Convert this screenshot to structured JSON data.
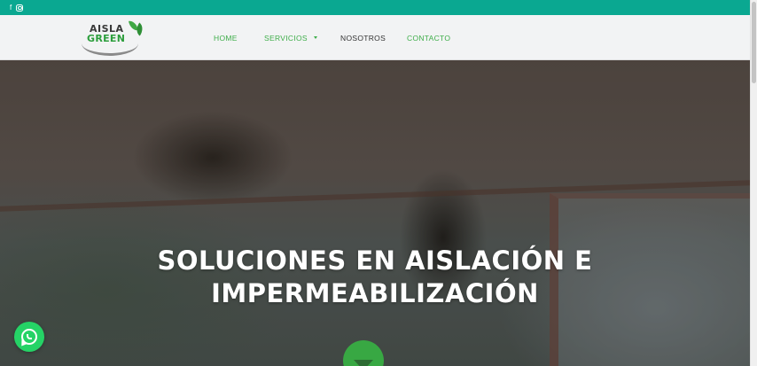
{
  "topbar": {
    "facebook_glyph": "f",
    "icons": [
      "facebook-icon",
      "instagram-icon"
    ],
    "color": "#0aa891"
  },
  "header": {
    "logo": {
      "line1": "AISLA",
      "line2": "GREEN"
    },
    "nav": [
      {
        "label": "HOME"
      },
      {
        "label": "SERVICIOS"
      },
      {
        "label": "NOSOTROS"
      },
      {
        "label": "CONTACTO"
      }
    ]
  },
  "hero": {
    "title_line1": "SOLUCIONES EN AISLACIÓN E",
    "title_line2": "IMPERMEABILIZACIÓN"
  },
  "colors": {
    "accent_green": "#3fae4a",
    "teal": "#0aa891",
    "whatsapp": "#25d366"
  },
  "icons": [
    "chevron-down-icon",
    "whatsapp-icon"
  ]
}
